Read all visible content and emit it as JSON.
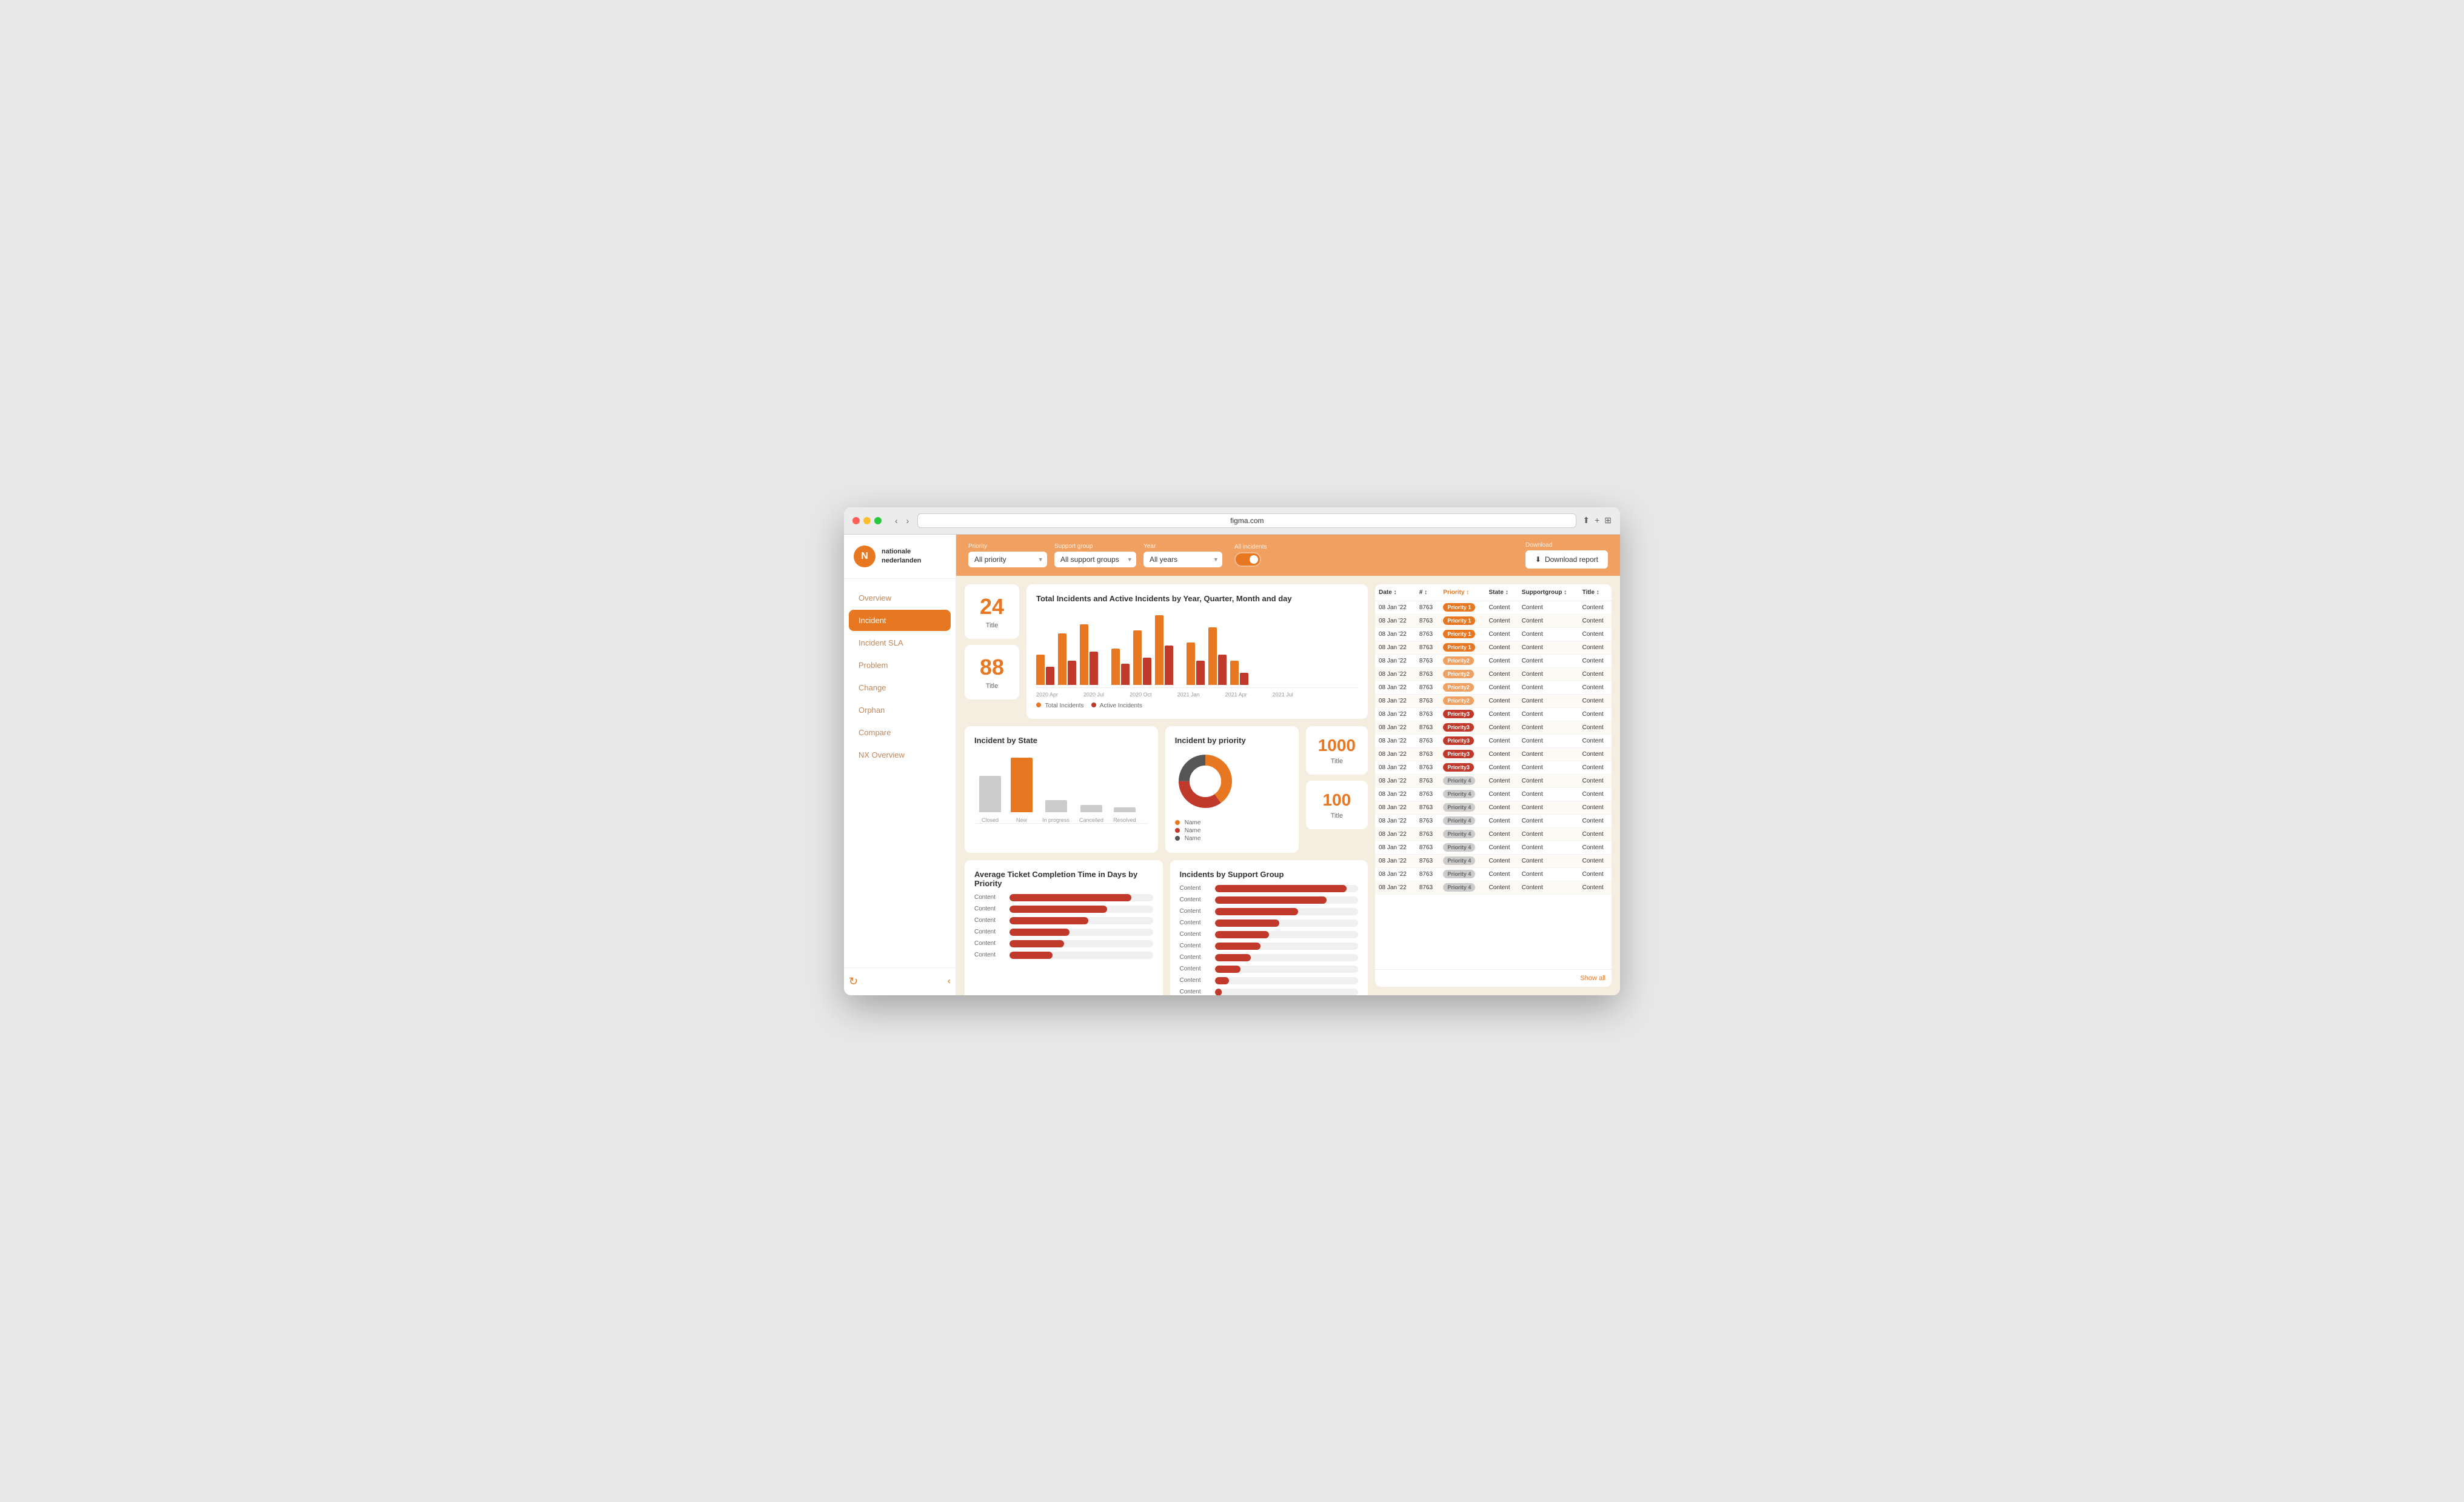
{
  "browser": {
    "url": "figma.com",
    "tab_label": "figma.com"
  },
  "header": {
    "filters": {
      "priority_label": "Priority",
      "priority_value": "All priority",
      "support_label": "Support group",
      "support_value": "All support groups",
      "year_label": "Year",
      "year_value": "All years",
      "incidents_label": "All incidents",
      "download_label": "Download",
      "download_btn": "Download report"
    }
  },
  "sidebar": {
    "logo_text_line1": "nationale",
    "logo_text_line2": "nederlanden",
    "nav_items": [
      {
        "label": "Overview",
        "active": false
      },
      {
        "label": "Incident",
        "active": true
      },
      {
        "label": "Incident SLA",
        "active": false
      },
      {
        "label": "Problem",
        "active": false
      },
      {
        "label": "Change",
        "active": false
      },
      {
        "label": "Orphan",
        "active": false
      },
      {
        "label": "Compare",
        "active": false
      },
      {
        "label": "NX Overview",
        "active": false
      }
    ]
  },
  "stats": {
    "card1_number": "24",
    "card1_label": "Title",
    "card2_number": "88",
    "card2_label": "Title",
    "card3_number": "1000",
    "card3_label": "Title",
    "card4_number": "100",
    "card4_label": "Title"
  },
  "charts": {
    "main_title": "Total Incidents and Active Incidents by Year, Quarter, Month and day",
    "bar_labels": [
      "2020 Apr",
      "2020 Jul",
      "2020 Oct",
      "2021 Jan",
      "2021 Apr",
      "2021 Jul"
    ],
    "legend_total": "Total Incidents",
    "legend_active": "Active Incidents",
    "state_title": "Incident by State",
    "state_labels": [
      "Closed",
      "New",
      "In progress",
      "Cancelled",
      "Resolved"
    ],
    "priority_title": "Incident by priority",
    "priority_legends": [
      "Name",
      "Name",
      "Name"
    ],
    "avg_title": "Average Ticket Completion Time in Days by Priority",
    "avg_bars": [
      {
        "label": "Content",
        "pct": 85
      },
      {
        "label": "Content",
        "pct": 68
      },
      {
        "label": "Content",
        "pct": 55
      },
      {
        "label": "Content",
        "pct": 42
      },
      {
        "label": "Content",
        "pct": 38
      },
      {
        "label": "Content",
        "pct": 30
      }
    ],
    "support_title": "Incidents by Support Group",
    "support_bars": [
      {
        "label": "Content",
        "pct": 92
      },
      {
        "label": "Content",
        "pct": 78
      },
      {
        "label": "Content",
        "pct": 58
      },
      {
        "label": "Content",
        "pct": 45
      },
      {
        "label": "Content",
        "pct": 38
      },
      {
        "label": "Content",
        "pct": 32
      },
      {
        "label": "Content",
        "pct": 25
      },
      {
        "label": "Content",
        "pct": 18
      },
      {
        "label": "Content",
        "pct": 10
      },
      {
        "label": "Content",
        "pct": 5
      }
    ]
  },
  "table": {
    "headers": [
      "Date",
      "#",
      "Priority",
      "State",
      "Supportgroup",
      "Title"
    ],
    "rows": [
      {
        "date": "08 Jan '22",
        "num": "8763",
        "priority": "Priority 1",
        "p_class": "p1",
        "state": "Content",
        "support": "Content",
        "title": "Content"
      },
      {
        "date": "08 Jan '22",
        "num": "8763",
        "priority": "Priority 1",
        "p_class": "p1",
        "state": "Content",
        "support": "Content",
        "title": "Content"
      },
      {
        "date": "08 Jan '22",
        "num": "8763",
        "priority": "Priority 1",
        "p_class": "p1",
        "state": "Content",
        "support": "Content",
        "title": "Content"
      },
      {
        "date": "08 Jan '22",
        "num": "8763",
        "priority": "Priority 1",
        "p_class": "p1",
        "state": "Content",
        "support": "Content",
        "title": "Content"
      },
      {
        "date": "08 Jan '22",
        "num": "8763",
        "priority": "Priority2",
        "p_class": "p2",
        "state": "Content",
        "support": "Content",
        "title": "Content"
      },
      {
        "date": "08 Jan '22",
        "num": "8763",
        "priority": "Priority2",
        "p_class": "p2",
        "state": "Content",
        "support": "Content",
        "title": "Content"
      },
      {
        "date": "08 Jan '22",
        "num": "8763",
        "priority": "Priority2",
        "p_class": "p2",
        "state": "Content",
        "support": "Content",
        "title": "Content"
      },
      {
        "date": "08 Jan '22",
        "num": "8763",
        "priority": "Priority2",
        "p_class": "p2",
        "state": "Content",
        "support": "Content",
        "title": "Content"
      },
      {
        "date": "08 Jan '22",
        "num": "8763",
        "priority": "Priority3",
        "p_class": "p3",
        "state": "Content",
        "support": "Content",
        "title": "Content"
      },
      {
        "date": "08 Jan '22",
        "num": "8763",
        "priority": "Priority3",
        "p_class": "p3",
        "state": "Content",
        "support": "Content",
        "title": "Content"
      },
      {
        "date": "08 Jan '22",
        "num": "8763",
        "priority": "Priority3",
        "p_class": "p3",
        "state": "Content",
        "support": "Content",
        "title": "Content"
      },
      {
        "date": "08 Jan '22",
        "num": "8763",
        "priority": "Priority3",
        "p_class": "p3",
        "state": "Content",
        "support": "Content",
        "title": "Content"
      },
      {
        "date": "08 Jan '22",
        "num": "8763",
        "priority": "Priority3",
        "p_class": "p3",
        "state": "Content",
        "support": "Content",
        "title": "Content"
      },
      {
        "date": "08 Jan '22",
        "num": "8763",
        "priority": "Priority 4",
        "p_class": "p4",
        "state": "Content",
        "support": "Content",
        "title": "Content"
      },
      {
        "date": "08 Jan '22",
        "num": "8763",
        "priority": "Priority 4",
        "p_class": "p4",
        "state": "Content",
        "support": "Content",
        "title": "Content"
      },
      {
        "date": "08 Jan '22",
        "num": "8763",
        "priority": "Priority 4",
        "p_class": "p4",
        "state": "Content",
        "support": "Content",
        "title": "Content"
      },
      {
        "date": "08 Jan '22",
        "num": "8763",
        "priority": "Priority 4",
        "p_class": "p4",
        "state": "Content",
        "support": "Content",
        "title": "Content"
      },
      {
        "date": "08 Jan '22",
        "num": "8763",
        "priority": "Priority 4",
        "p_class": "p4",
        "state": "Content",
        "support": "Content",
        "title": "Content"
      },
      {
        "date": "08 Jan '22",
        "num": "8763",
        "priority": "Priority 4",
        "p_class": "p4",
        "state": "Content",
        "support": "Content",
        "title": "Content"
      },
      {
        "date": "08 Jan '22",
        "num": "8763",
        "priority": "Priority 4",
        "p_class": "p4",
        "state": "Content",
        "support": "Content",
        "title": "Content"
      },
      {
        "date": "08 Jan '22",
        "num": "8763",
        "priority": "Priority 4",
        "p_class": "p4",
        "state": "Content",
        "support": "Content",
        "title": "Content"
      },
      {
        "date": "08 Jan '22",
        "num": "8763",
        "priority": "Priority 4",
        "p_class": "p4",
        "state": "Content",
        "support": "Content",
        "title": "Content"
      }
    ],
    "show_all_label": "Show all"
  }
}
